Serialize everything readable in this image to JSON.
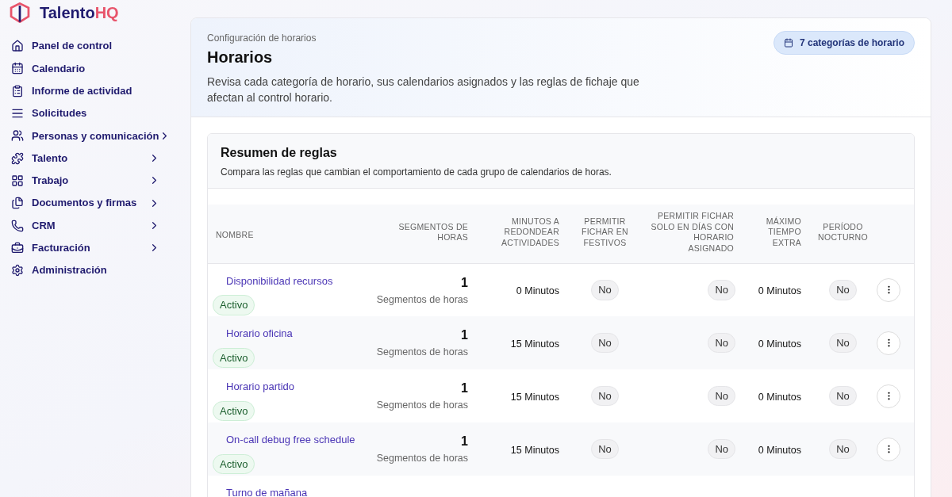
{
  "logo": {
    "name": "Talento",
    "suffix": "HQ"
  },
  "sidebar": {
    "items": [
      {
        "label": "Panel de control",
        "has_submenu": false
      },
      {
        "label": "Calendario",
        "has_submenu": false
      },
      {
        "label": "Informe de actividad",
        "has_submenu": false
      },
      {
        "label": "Solicitudes",
        "has_submenu": false
      },
      {
        "label": "Personas y comunicación",
        "has_submenu": true
      },
      {
        "label": "Talento",
        "has_submenu": true
      },
      {
        "label": "Trabajo",
        "has_submenu": true
      },
      {
        "label": "Documentos y firmas",
        "has_submenu": true
      },
      {
        "label": "CRM",
        "has_submenu": true
      },
      {
        "label": "Facturación",
        "has_submenu": true
      },
      {
        "label": "Administración",
        "has_submenu": false
      }
    ]
  },
  "header": {
    "breadcrumb": "Configuración de horarios",
    "title": "Horarios",
    "description": "Revisa cada categoría de horario, sus calendarios asignados y las reglas de fichaje que afectan al control horario.",
    "badge": "7 categorías de horario"
  },
  "summary": {
    "title": "Resumen de reglas",
    "subtitle": "Compara las reglas que cambian el comportamiento de cada grupo de calendarios de horas."
  },
  "table": {
    "columns": [
      "NOMBRE",
      "SEGMENTOS DE HORAS",
      "MINUTOS A REDONDEAR ACTIVIDADES",
      "PERMITIR FICHAR EN FESTIVOS",
      "PERMITIR FICHAR SOLO EN DÍAS CON HORARIO ASIGNADO",
      "MÁXIMO TIEMPO EXTRA",
      "PERÍODO NOCTURNO"
    ],
    "rows": [
      {
        "name": "Disponibilidad recursos",
        "status": "Activo",
        "segments": "1",
        "segments_label": "Segmentos de horas",
        "rounding": "0 Minutos",
        "holidays": "No",
        "assigned_only": "No",
        "max_extra": "0 Minutos",
        "night": "No"
      },
      {
        "name": "Horario oficina",
        "status": "Activo",
        "segments": "1",
        "segments_label": "Segmentos de horas",
        "rounding": "15 Minutos",
        "holidays": "No",
        "assigned_only": "No",
        "max_extra": "0 Minutos",
        "night": "No"
      },
      {
        "name": "Horario partido",
        "status": "Activo",
        "segments": "1",
        "segments_label": "Segmentos de horas",
        "rounding": "15 Minutos",
        "holidays": "No",
        "assigned_only": "No",
        "max_extra": "0 Minutos",
        "night": "No"
      },
      {
        "name": "On-call debug free schedule",
        "status": "Activo",
        "segments": "1",
        "segments_label": "Segmentos de horas",
        "rounding": "15 Minutos",
        "holidays": "No",
        "assigned_only": "No",
        "max_extra": "0 Minutos",
        "night": "No"
      },
      {
        "name": "Turno de mañana"
      }
    ]
  }
}
